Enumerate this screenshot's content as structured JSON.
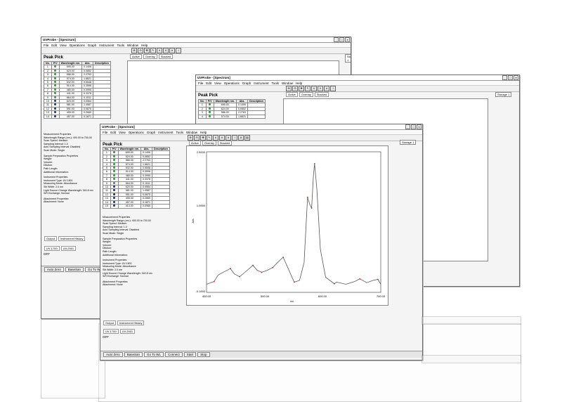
{
  "app": {
    "title": "UVProbe - [Spectrum]"
  },
  "menu": [
    "File",
    "Edit",
    "View",
    "Operations",
    "Graph",
    "Instrument",
    "Tools",
    "Window",
    "Help"
  ],
  "peak_pick": {
    "title": "Peak Pick",
    "columns": [
      "No.",
      "P/V",
      "Wavelength nm.",
      "Abs.",
      "Description"
    ],
    "rows": [
      {
        "no": "1",
        "pv": "peak",
        "wl": "695.00",
        "abs": "0.1406"
      },
      {
        "no": "2",
        "pv": "peak",
        "wl": "624.00",
        "abs": "0.0852"
      },
      {
        "no": "3",
        "pv": "peak",
        "wl": "586.00",
        "abs": "2.2763"
      },
      {
        "no": "4",
        "pv": "peak",
        "wl": "574.00",
        "abs": "1.6621"
      },
      {
        "no": "5",
        "pv": "peak",
        "wl": "532.00",
        "abs": "0.5548"
      },
      {
        "no": "6",
        "pv": "peak",
        "wl": "514.00",
        "abs": "0.3596"
      },
      {
        "no": "7",
        "pv": "peak",
        "wl": "480.00",
        "abs": "0.3995"
      },
      {
        "no": "8",
        "pv": "peak",
        "wl": "441.00",
        "abs": "0.3378"
      },
      {
        "no": "9",
        "pv": "peak",
        "wl": "664.00",
        "abs": "0.1511"
      },
      {
        "no": "10",
        "pv": "valley",
        "wl": "620.00",
        "abs": "0.0564"
      },
      {
        "no": "11",
        "pv": "valley",
        "wl": "581.00",
        "abs": "1.4587"
      },
      {
        "no": "12",
        "pv": "valley",
        "wl": "551.00",
        "abs": "0.0875"
      },
      {
        "no": "13",
        "pv": "valley",
        "wl": "495.00",
        "abs": "0.2669"
      },
      {
        "no": "14",
        "pv": "valley",
        "wl": "457.00",
        "abs": "0.1871"
      },
      {
        "no": "15",
        "pv": "valley",
        "wl": "413.00",
        "abs": "0.0965"
      }
    ]
  },
  "properties": {
    "measurement_header": "Measurement Properties",
    "measurement": [
      "Wavelength Range (nm.):      400.00 to 700.00",
      "Scan Speed:      Medium",
      "Sampling Interval:      1.0",
      "Auto Sampling Interval:      Disabled",
      "Scan Mode:      Single"
    ],
    "sample_header": "Sample Preparation Properties",
    "sample": [
      "Weight:",
      "Volume:",
      "Dilution:",
      "Path Length:",
      "Additional Information:"
    ],
    "instrument_header": "Instrument Properties",
    "instrument": [
      "Instrument Type:      UV-1601",
      "Measuring Mode:      Absorbance",
      "Slit Width:      2.0 nm",
      "Light Source Change Wavelength:      340.8 nm",
      "S/R Exchange:      Normal"
    ],
    "attachment_header": "Attachment Properties",
    "attachment": [
      "Attachment:      None"
    ]
  },
  "graph_tabs": [
    "Active",
    "Overlay",
    "Stacked"
  ],
  "output_tabs": [
    "Output",
    "Instrument History"
  ],
  "instrument_tabs": [
    "UV-1700",
    "UV-2501"
  ],
  "status_text": "OFF",
  "bottom_buttons": [
    "Auto Zero",
    "BaseSan",
    "Go To WL",
    "Connect",
    "Start",
    "Stop"
  ],
  "storage_label": "Storage 1",
  "colors": {
    "peak": "#2a9a2a",
    "valley": "#1a2a8a",
    "trace": "#555555",
    "marker": "#cc2222"
  },
  "chart_data": {
    "type": "line",
    "title": "",
    "xlabel": "nm.",
    "ylabel": "Abs.",
    "xlim": [
      400.0,
      700.0
    ],
    "ylim": [
      -0.1,
      2.5
    ],
    "x_ticks": [
      "400.00",
      "500.00",
      "600.00",
      "700.00"
    ],
    "y_ticks": [
      "2.5000",
      "1.0000",
      "-0.1000"
    ],
    "series": [
      {
        "x": [
          400,
          413,
          420,
          430,
          441,
          448,
          457,
          466,
          480,
          487,
          495,
          505,
          514,
          522,
          532,
          541,
          551,
          560,
          568,
          574,
          578,
          581,
          584,
          586,
          590,
          596,
          605,
          620,
          624,
          640,
          655,
          664,
          676,
          686,
          695,
          700
        ],
        "y": [
          0.05,
          0.1,
          0.22,
          0.28,
          0.34,
          0.24,
          0.19,
          0.27,
          0.4,
          0.31,
          0.27,
          0.31,
          0.36,
          0.45,
          0.55,
          0.33,
          0.09,
          0.12,
          0.45,
          1.66,
          1.52,
          1.46,
          2.05,
          2.28,
          1.8,
          0.7,
          0.18,
          0.06,
          0.09,
          0.05,
          0.1,
          0.15,
          0.08,
          0.12,
          0.14,
          0.05
        ]
      }
    ],
    "peaks": [
      {
        "x": 586,
        "y": 2.28
      },
      {
        "x": 574,
        "y": 1.66
      },
      {
        "x": 532,
        "y": 0.55
      },
      {
        "x": 514,
        "y": 0.36
      },
      {
        "x": 480,
        "y": 0.4
      },
      {
        "x": 441,
        "y": 0.34
      },
      {
        "x": 664,
        "y": 0.15
      },
      {
        "x": 695,
        "y": 0.14
      }
    ],
    "valleys": [
      {
        "x": 581,
        "y": 1.46
      },
      {
        "x": 551,
        "y": 0.09
      },
      {
        "x": 495,
        "y": 0.27
      },
      {
        "x": 457,
        "y": 0.19
      },
      {
        "x": 413,
        "y": 0.1
      },
      {
        "x": 620,
        "y": 0.06
      }
    ]
  }
}
